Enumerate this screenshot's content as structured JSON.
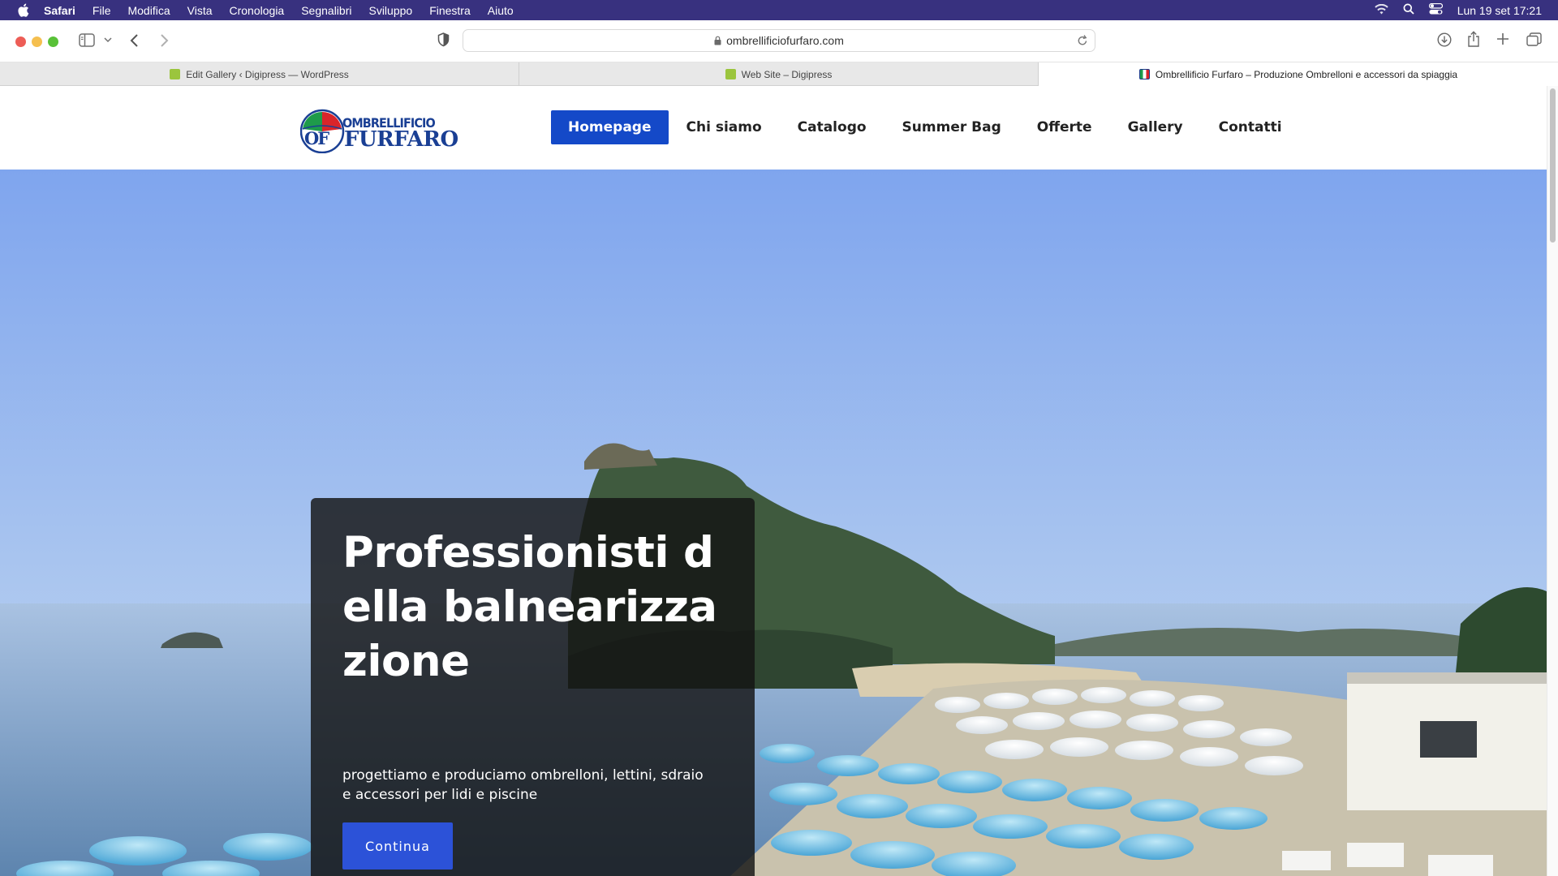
{
  "menubar": {
    "app": "Safari",
    "items": [
      "File",
      "Modifica",
      "Vista",
      "Cronologia",
      "Segnalibri",
      "Sviluppo",
      "Finestra",
      "Aiuto"
    ],
    "clock": "Lun 19 set  17:21"
  },
  "browser": {
    "url": "ombrellificiofurfaro.com",
    "tabs": [
      {
        "title": "Edit Gallery ‹ Digipress — WordPress",
        "active": false
      },
      {
        "title": "Web Site – Digipress",
        "active": false
      },
      {
        "title": "Ombrellificio Furfaro – Produzione Ombrelloni e accessori da spiaggia",
        "active": true
      }
    ]
  },
  "site": {
    "logo": {
      "line1": "OMBRELLIFICIO",
      "line2": "FURFARO",
      "monogram": "OF"
    },
    "nav": [
      "Homepage",
      "Chi siamo",
      "Catalogo",
      "Summer Bag",
      "Offerte",
      "Gallery",
      "Contatti"
    ],
    "hero": {
      "title": "Professionisti della balnearizzazione",
      "subtitle": "progettiamo e produciamo ombrelloni, lettini, sdraio e accessori per lidi e piscine",
      "button": "Continua"
    }
  },
  "colors": {
    "menubar": "#38317f",
    "nav_active": "#1449c8",
    "button": "#2c52d8",
    "logo_blue": "#1a3f94",
    "logo_red": "#d9252a",
    "logo_green": "#1e9b4a"
  }
}
